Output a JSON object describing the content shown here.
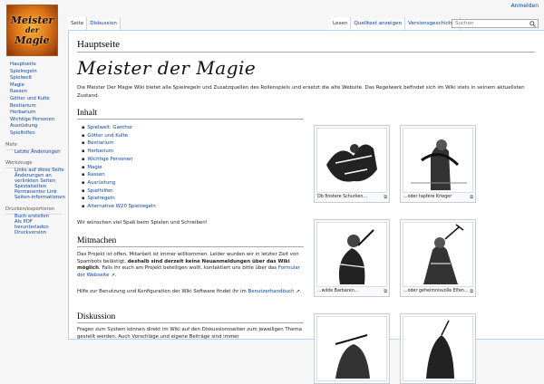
{
  "personal": {
    "login": "Anmelden"
  },
  "logo": {
    "line1": "Meister",
    "line2": "der",
    "line3": "Magie"
  },
  "sidebar": {
    "nav": [
      "Hauptseite",
      "Spielregeln",
      "Spielwelt",
      "Magie",
      "Rassen",
      "Götter und Kulte",
      "Bestiarium",
      "Herbarium",
      "Wichtige Personen",
      "Ausrüstung",
      "Spielhilfen"
    ],
    "mehr_label": "Mehr",
    "mehr_items": [
      "Letzte Änderungen"
    ],
    "werkzeuge_label": "Werkzeuge",
    "werkzeuge_items": [
      "Links auf diese Seite",
      "Änderungen an verlinkten Seiten",
      "Spezialseiten",
      "Permanenter Link",
      "Seiten-informationen"
    ],
    "drucken_label": "Drucken/exportieren",
    "drucken_items": [
      "Buch erstellen",
      "Als PDF herunterladen",
      "Druckversion"
    ]
  },
  "tabs": {
    "left": [
      "Seite",
      "Diskussion"
    ],
    "right": [
      "Lesen",
      "Quelltext anzeigen",
      "Versionsgeschichte"
    ]
  },
  "search": {
    "placeholder": "Suchen"
  },
  "page": {
    "title": "Hauptseite",
    "brand": "Meister der Magie",
    "intro": "Die Meister Der Magie Wiki bietet alle Spielregeln und Zusatzquellen des Rollenspiels und ersetzt die alte Website. Das Regelwerk befindet sich im Wiki stets in seinem aktuellsten Zustand.",
    "inhalt_heading": "Inhalt",
    "toc": [
      "Spielwelt: Ganthor",
      "Götter und Kulte",
      "Bestiarium",
      "Herbarium",
      "Wichtige Personen",
      "Magie",
      "Rassen",
      "Ausrüstung",
      "Spielhilfen",
      "Spielregeln",
      "Alternative W20 Spielregeln"
    ],
    "wish": "Wir wünschen viel Spaß beim Spielen und Schreiben!",
    "mitmachen_heading": "Mitmachen",
    "mitmachen_p1a": "Das Projekt ist offen, Mitarbeit ist immer willkommen. Leider wurden wir in letzter Zeit von Spambots belästigt, ",
    "mitmachen_p1b": "deshalb sind derzeit keine Neuanmeldungen über das Wiki möglich",
    "mitmachen_p1c": ". Falls ihr euch am Projekt beteiligen wollt, kontaktiert uns bitte über das ",
    "mitmachen_link": "Formular der Webseite",
    "mitmachen_p1d": ".",
    "mitmachen_p2a": "Hilfe zur Benutzung und Konfiguration der Wiki Software findet ihr im ",
    "mitmachen_link2": "Benutzerhandbuch",
    "mitmachen_p2b": ".",
    "diskussion_heading": "Diskussion",
    "diskussion_text": "Fragen zum System können direkt im Wiki auf den Diskussionsseiten zum jeweiligen Thema gestellt werden. Auch Vorschläge und eigene Beiträge sind immer"
  },
  "thumbs": [
    {
      "caption": "Ob finstere Schurken..."
    },
    {
      "caption": "...oder tapfere Krieger"
    },
    {
      "caption": "...wilde Barbaren..."
    },
    {
      "caption": "...oder geheimnisvolle Elfen..."
    },
    {
      "caption": ""
    },
    {
      "caption": ""
    }
  ]
}
